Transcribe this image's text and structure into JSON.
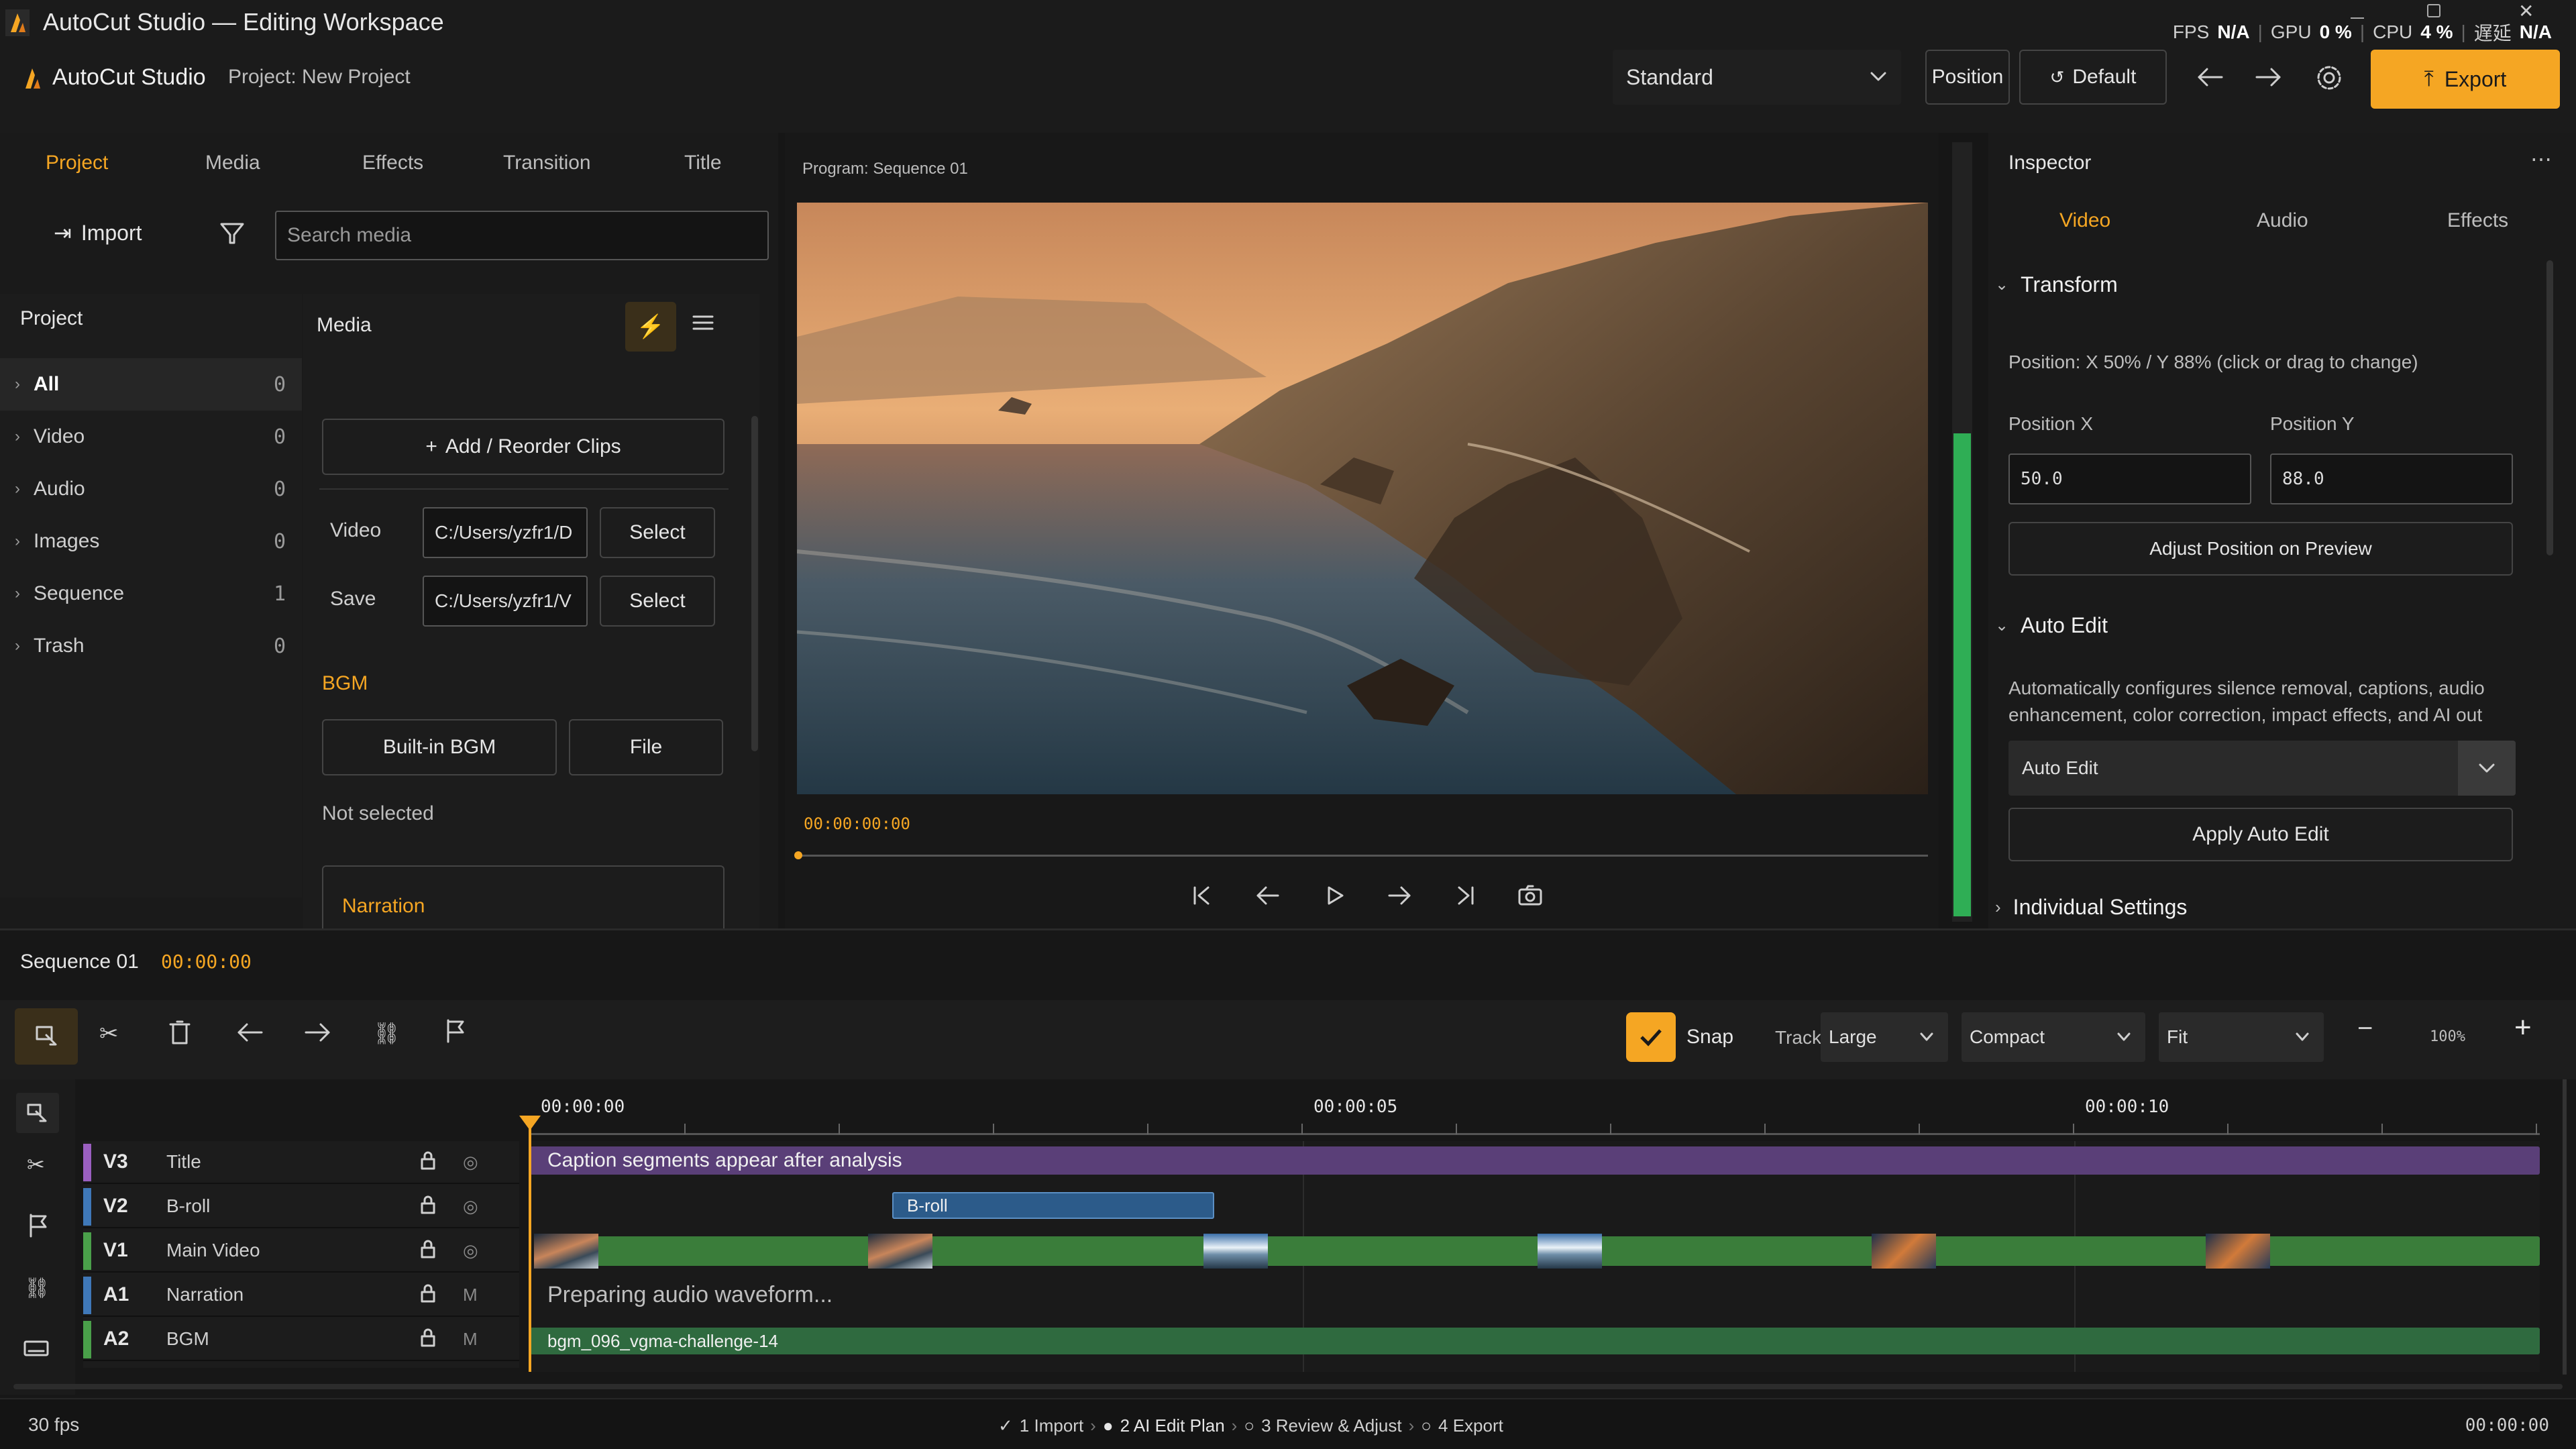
{
  "window": {
    "title": "AutoCut Studio — Editing Workspace"
  },
  "sysinfo": {
    "fps_label": "FPS",
    "fps_value": "N/A",
    "gpu_label": "GPU",
    "gpu_value": "0 %",
    "cpu_label": "CPU",
    "cpu_value": "4 %",
    "latency_label": "遅延",
    "latency_value": "N/A"
  },
  "header": {
    "app_name": "AutoCut Studio",
    "project": "Project: New Project",
    "layout_select": "Standard",
    "position_btn": "Position",
    "default_btn": "Default",
    "export_btn": "Export"
  },
  "left": {
    "tabs": [
      "Project",
      "Media",
      "Effects",
      "Transition",
      "Title"
    ],
    "active_tab": "Project",
    "import_btn": "Import",
    "search_placeholder": "Search media",
    "tree_title": "Project",
    "tree": [
      {
        "label": "All",
        "count": "0"
      },
      {
        "label": "Video",
        "count": "0"
      },
      {
        "label": "Audio",
        "count": "0"
      },
      {
        "label": "Images",
        "count": "0"
      },
      {
        "label": "Sequence",
        "count": "1"
      },
      {
        "label": "Trash",
        "count": "0"
      }
    ],
    "media_title": "Media",
    "add_clips_btn": "Add / Reorder Clips",
    "video_label": "Video",
    "video_path": "C:/Users/yzfr1/D",
    "save_label": "Save",
    "save_path": "C:/Users/yzfr1/V",
    "select_btn": "Select",
    "bgm_title": "BGM",
    "builtin_bgm_btn": "Built-in BGM",
    "file_btn": "File",
    "bgm_status": "Not selected",
    "narration_title": "Narration"
  },
  "preview": {
    "title": "Program: Sequence 01",
    "timecode": "00:00:00:00"
  },
  "inspector": {
    "title": "Inspector",
    "tabs": [
      "Video",
      "Audio",
      "Effects"
    ],
    "active_tab": "Video",
    "transform_title": "Transform",
    "position_hint": "Position: X 50% / Y 88% (click or drag to change)",
    "pos_x_label": "Position X",
    "pos_x_value": "50.0",
    "pos_y_label": "Position Y",
    "pos_y_value": "88.0",
    "adjust_btn": "Adjust Position on Preview",
    "autoedit_title": "Auto Edit",
    "autoedit_desc": "Automatically configures silence removal, captions, audio enhancement, color correction, impact effects, and AI out",
    "autoedit_select": "Auto Edit",
    "apply_btn": "Apply Auto Edit",
    "individual_title": "Individual Settings"
  },
  "timeline": {
    "sequence_name": "Sequence 01",
    "sequence_time": "00:00:00",
    "snap_label": "Snap",
    "track_label": "Track",
    "track_size": "Large",
    "density": "Compact",
    "zoom_mode": "Fit",
    "zoom_pct": "100%",
    "ruler": [
      "00:00:00",
      "00:00:05",
      "00:00:10"
    ],
    "tracks": [
      {
        "code": "V3",
        "name": "Title",
        "color": "#9a5fc0",
        "toggle": "eye"
      },
      {
        "code": "V2",
        "name": "B-roll",
        "color": "#3f78b8",
        "toggle": "eye"
      },
      {
        "code": "V1",
        "name": "Main Video",
        "color": "#4aa04a",
        "toggle": "eye"
      },
      {
        "code": "A1",
        "name": "Narration",
        "color": "#3f78b8",
        "toggle": "M"
      },
      {
        "code": "A2",
        "name": "BGM",
        "color": "#4aa04a",
        "toggle": "M"
      }
    ],
    "caption_clip": "Caption segments appear after analysis",
    "broll_clip": "B-roll",
    "narration_status": "Preparing audio waveform...",
    "bgm_clip": "bgm_096_vgma-challenge-14"
  },
  "status": {
    "fps": "30 fps",
    "steps": [
      "1 Import",
      "2 AI Edit Plan",
      "3 Review & Adjust",
      "4 Export"
    ],
    "timecode": "00:00:00"
  },
  "colors": {
    "accent": "#f5a623",
    "green": "#3a7d3a",
    "purple": "#5a3f78",
    "blue": "#2c5b8a"
  }
}
